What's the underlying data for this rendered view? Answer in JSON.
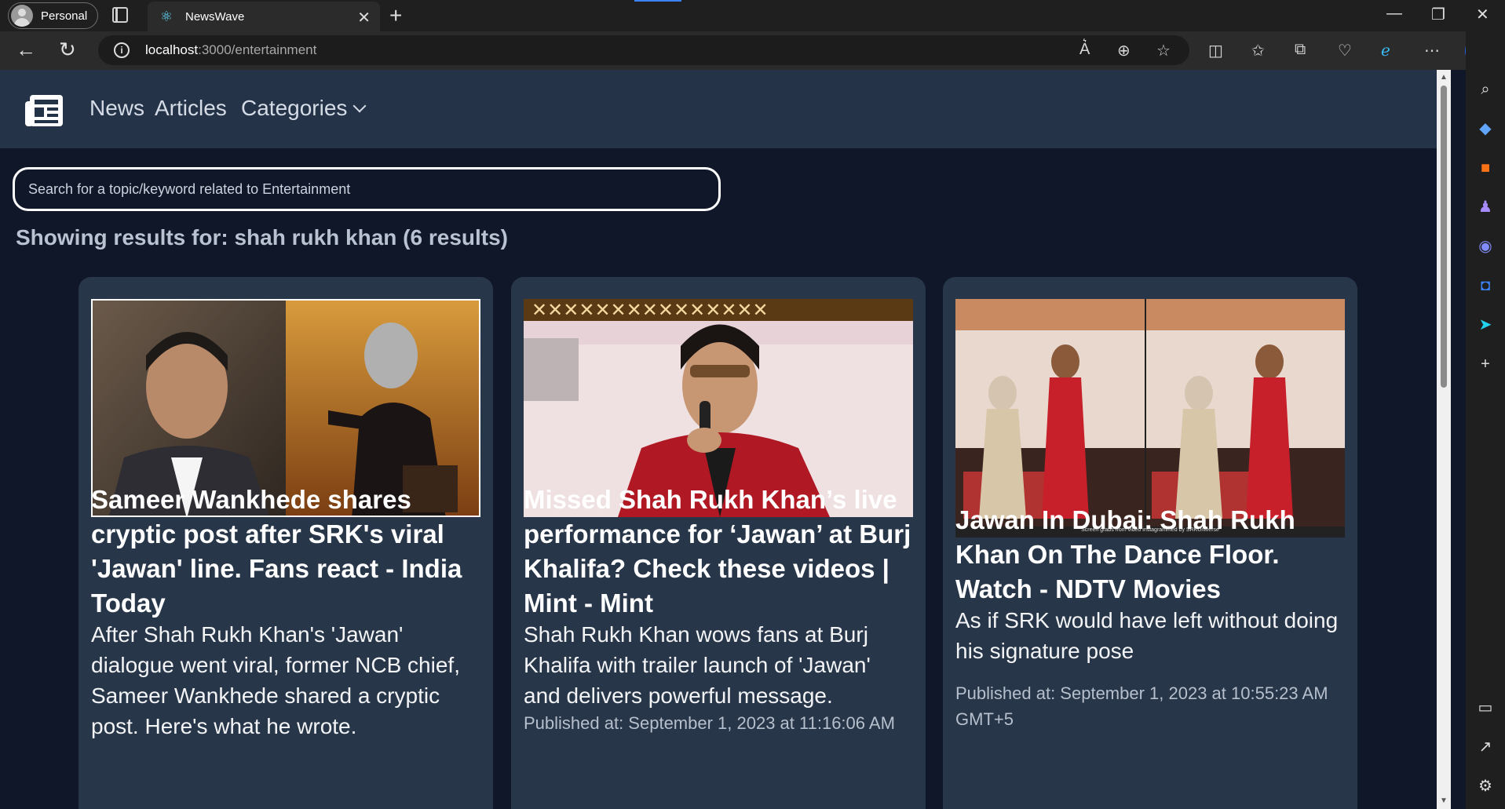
{
  "browser": {
    "profile_label": "Personal",
    "tab_title": "NewsWave",
    "url_host": "localhost",
    "url_rest": ":3000/entertainment"
  },
  "nav": {
    "news": "News",
    "articles": "Articles",
    "categories": "Categories"
  },
  "search": {
    "placeholder": "Search for a topic/keyword related to Entertainment"
  },
  "results_text": "Showing results for: shah rukh khan (6 results)",
  "cards": [
    {
      "title": "Sameer Wankhede shares cryptic post after SRK's viral 'Jawan' line. Fans react - India Today",
      "description": "After Shah Rukh Khan's 'Jawan' dialogue went viral, former NCB chief, Sameer Wankhede shared a cryptic post. Here's what he wrote.",
      "published": ""
    },
    {
      "title": "Missed Shah Rukh Khan’s live performance for ‘Jawan’ at Burj Khalifa? Check these videos | Mint - Mint",
      "description": "Shah Rukh Khan wows fans at Burj Khalifa with trailer launch of 'Jawan' and delivers powerful message.",
      "published": "Published at: September 1, 2023 at 11:16:06 AM"
    },
    {
      "title": "Jawan In Dubai: Shah Rukh Khan On The Dance Floor. Watch - NDTV Movies",
      "description": "As if SRK would have left without doing his signature pose",
      "published": "Published at: September 1, 2023 at 10:55:23 AM GMT+5",
      "image_caption": "Screen grabs from video instagrammed by SRKUniverse"
    }
  ]
}
